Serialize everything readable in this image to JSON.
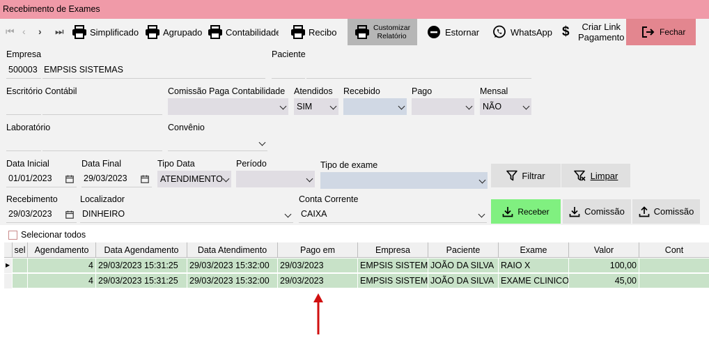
{
  "window": {
    "title": "Recebimento de Exames"
  },
  "toolbar": {
    "simplificado": "Simplificado",
    "agrupado": "Agrupado",
    "contabilidade": "Contabilidade",
    "recibo": "Recibo",
    "customizar_line1": "Customizar",
    "customizar_line2": "Relatório",
    "estornar": "Estornar",
    "whatsapp": "WhatsApp",
    "criar_link_line1": "Criar Link",
    "criar_link_line2": "Pagamento",
    "fechar": "Fechar"
  },
  "form": {
    "empresa_label": "Empresa",
    "empresa_code": "500003",
    "empresa_name": "EMPSIS SISTEMAS",
    "paciente_label": "Paciente",
    "paciente_value": "",
    "escritorio_label": "Escritório Contábil",
    "comissao_label": "Comissão Paga Contabilidade",
    "comissao_value": "",
    "atendidos_label": "Atendidos",
    "atendidos_value": "SIM",
    "recebido_label": "Recebido",
    "recebido_value": "",
    "pago_label": "Pago",
    "pago_value": "",
    "mensal_label": "Mensal",
    "mensal_value": "NÃO",
    "laboratorio_label": "Laboratório",
    "convenio_label": "Convênio",
    "convenio_value": "",
    "data_inicial_label": "Data Inicial",
    "data_inicial_value": "01/01/2023",
    "data_final_label": "Data Final",
    "data_final_value": "29/03/2023",
    "tipo_data_label": "Tipo Data",
    "tipo_data_value": "ATENDIMENTO",
    "periodo_label": "Período",
    "periodo_value": "",
    "tipo_exame_label": "Tipo de exame",
    "tipo_exame_value": "",
    "filtrar": "Filtrar",
    "limpar": "Limpar",
    "recebimento_label": "Recebimento",
    "recebimento_value": "29/03/2023",
    "localizador_label": "Localizador",
    "localizador_value": "DINHEIRO",
    "conta_corrente_label": "Conta Corrente",
    "conta_corrente_value": "CAIXA",
    "receber": "Receber",
    "comissao_down": "Comissão",
    "comissao_up": "Comissão"
  },
  "grid": {
    "select_all": "Selecionar todos",
    "headers": [
      "sel",
      "Agendamento",
      "Data Agendamento",
      "Data Atendimento",
      "Pago em",
      "Empresa",
      "Paciente",
      "Exame",
      "Valor",
      "Cont"
    ],
    "rows": [
      {
        "agendamento": "4",
        "data_agendamento": "29/03/2023 15:31:25",
        "data_atendimento": "29/03/2023 15:32:00",
        "pago_em": "29/03/2023",
        "empresa": "EMPSIS SISTEMAS",
        "paciente": "JOÃO DA SILVA",
        "exame": "RAIO X",
        "valor": "100,00"
      },
      {
        "agendamento": "4",
        "data_agendamento": "29/03/2023 15:31:25",
        "data_atendimento": "29/03/2023 15:32:00",
        "pago_em": "29/03/2023",
        "empresa": "EMPSIS SISTEMAS",
        "paciente": "JOÃO DA SILVA",
        "exame": "EXAME CLINICO O",
        "valor": "45,00"
      }
    ]
  },
  "colors": {
    "title_bar": "#f09aa8",
    "fechar": "#e3868f",
    "receber": "#80f080",
    "row_green": "#c8e2c8",
    "arrow": "#d01010"
  }
}
